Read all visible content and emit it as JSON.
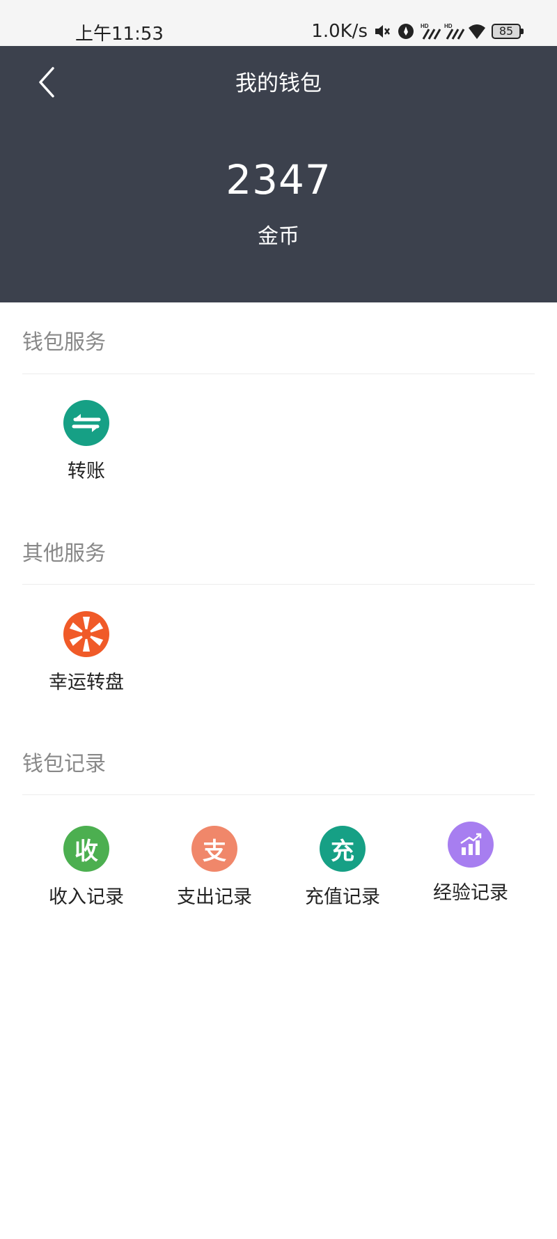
{
  "status_bar": {
    "time": "上午11:53",
    "speed": "1.0K/s",
    "battery": "85"
  },
  "header": {
    "title": "我的钱包",
    "balance": "2347",
    "unit": "金币"
  },
  "sections": {
    "wallet_service": {
      "title": "钱包服务",
      "items": [
        {
          "label": "转账",
          "icon": "transfer-icon",
          "color": "#16a085"
        }
      ]
    },
    "other_service": {
      "title": "其他服务",
      "items": [
        {
          "label": "幸运转盘",
          "icon": "lucky-wheel-icon",
          "color": "#f05a28"
        }
      ]
    },
    "wallet_records": {
      "title": "钱包记录",
      "items": [
        {
          "label": "收入记录",
          "glyph": "收",
          "icon": "income-icon",
          "color": "#4caf50"
        },
        {
          "label": "支出记录",
          "glyph": "支",
          "icon": "expense-icon",
          "color": "#f0876a"
        },
        {
          "label": "充值记录",
          "glyph": "充",
          "icon": "recharge-icon",
          "color": "#16a085"
        },
        {
          "label": "经验记录",
          "icon": "experience-chart-icon",
          "color": "#a77ef0"
        }
      ]
    }
  }
}
